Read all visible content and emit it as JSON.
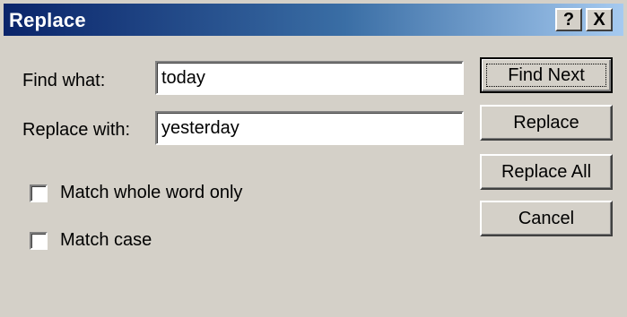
{
  "window": {
    "title": "Replace",
    "help_button": "?",
    "close_button": "X"
  },
  "find": {
    "label": "Find what:",
    "value": "today"
  },
  "replace": {
    "label": "Replace with:",
    "value": "yesterday"
  },
  "options": {
    "whole_word": {
      "label": "Match whole word only",
      "checked": false
    },
    "match_case": {
      "label": "Match case",
      "checked": false
    }
  },
  "buttons": {
    "find_next": "Find Next",
    "replace": "Replace",
    "replace_all": "Replace All",
    "cancel": "Cancel"
  },
  "colors": {
    "titlebar_start": "#0a246a",
    "titlebar_end": "#a6caf0",
    "face": "#d4d0c8"
  }
}
